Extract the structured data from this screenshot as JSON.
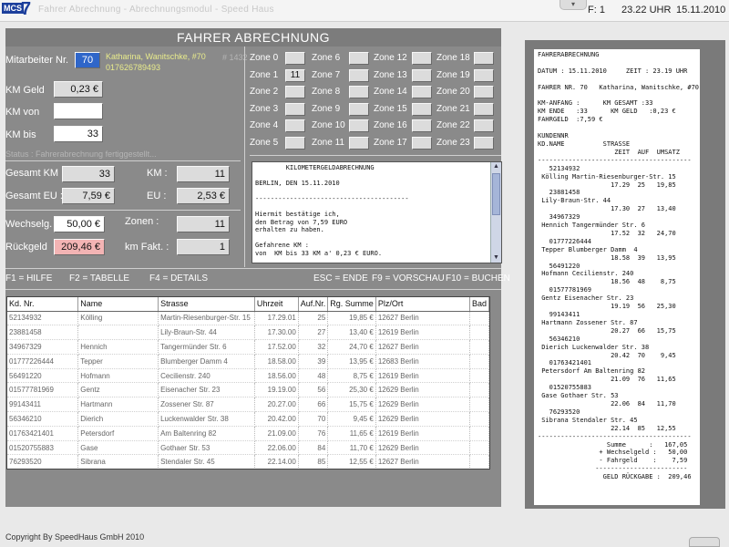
{
  "topbar": {
    "logo_text": "MCS",
    "logo_number": "7",
    "title": "Fahrer Abrechnung - Abrechnungsmodul - Speed Haus",
    "tab_symbol": "▾",
    "field_label": "F: 1",
    "time": "23.22 UHR",
    "date": "15.11.2010"
  },
  "header": {
    "title": "FAHRER ABRECHNUNG"
  },
  "form": {
    "mitarbeiter_label": "Mitarbeiter Nr.",
    "mitarbeiter_value": "70",
    "mitarbeiter_name": "Katharina, Wanitschke, #70",
    "mitarbeiter_phone": "017626789493",
    "terminal": "# 1432",
    "km_geld_label": "KM Geld",
    "km_geld_value": "0,23 €",
    "km_von_label": "KM von",
    "km_von_value": "",
    "km_bis_label": "KM bis",
    "km_bis_value": "33",
    "status_text": "Status : Fahrerabrechnung fertiggestellt...",
    "gesamt_km_label": "Gesamt KM :",
    "gesamt_km_value": "33",
    "km_label": "KM :",
    "km_value": "11",
    "gesamt_eu_label": "Gesamt EU :",
    "gesamt_eu_value": "7,59 €",
    "eu_label": "EU :",
    "eu_value": "2,53 €",
    "wechselg_label": "Wechselg.",
    "wechselg_value": "50,00 €",
    "zonen_label": "Zonen      :",
    "zonen_value": "11",
    "rueckgeld_label": "Rückgeld",
    "rueckgeld_value": "209,46 €",
    "km_fakt_label": "km Fakt. :",
    "km_fakt_value": "1"
  },
  "zones": [
    {
      "label": "Zone  0",
      "value": ""
    },
    {
      "label": "Zone  1",
      "value": "11"
    },
    {
      "label": "Zone  2",
      "value": ""
    },
    {
      "label": "Zone  3",
      "value": ""
    },
    {
      "label": "Zone  4",
      "value": ""
    },
    {
      "label": "Zone  5",
      "value": ""
    },
    {
      "label": "Zone  6",
      "value": ""
    },
    {
      "label": "Zone  7",
      "value": ""
    },
    {
      "label": "Zone  8",
      "value": ""
    },
    {
      "label": "Zone  9",
      "value": ""
    },
    {
      "label": "Zone 10",
      "value": ""
    },
    {
      "label": "Zone 11",
      "value": ""
    },
    {
      "label": "Zone 12",
      "value": ""
    },
    {
      "label": "Zone 13",
      "value": ""
    },
    {
      "label": "Zone 14",
      "value": ""
    },
    {
      "label": "Zone 15",
      "value": ""
    },
    {
      "label": "Zone 16",
      "value": ""
    },
    {
      "label": "Zone 17",
      "value": ""
    },
    {
      "label": "Zone 18",
      "value": ""
    },
    {
      "label": "Zone 19",
      "value": ""
    },
    {
      "label": "Zone 20",
      "value": ""
    },
    {
      "label": "Zone 21",
      "value": ""
    },
    {
      "label": "Zone 22",
      "value": ""
    },
    {
      "label": "Zone 23",
      "value": ""
    }
  ],
  "km_text": "        KILOMETERGELDABRECHNUNG\n\nBERLIN, DEN 15.11.2010\n\n----------------------------------------\n\nHiermit bestätige ich,\nden Betrag von 7,59 EURO\nerhalten zu haben.\n\nGefahrene KM :\nvon  KM bis 33 KM a' 0,23 € EURO.",
  "scroll_up": "▲",
  "scroll_down": "▼",
  "fkeys": {
    "f1": "F1 = HILFE",
    "f2": "F2 = TABELLE",
    "f4": "F4 = DETAILS",
    "esc": "ESC = ENDE",
    "f9": "F9 = VORSCHAU",
    "f10": "F10 = BUCHEN"
  },
  "table": {
    "headers": [
      "Kd. Nr.",
      "Name",
      "Strasse",
      "Uhrzeit",
      "Auf.Nr.",
      "Rg. Summe",
      "Plz/Ort",
      "Bad"
    ],
    "rows": [
      [
        "52134932",
        "Kölling",
        "Martin-Riesenburger-Str. 15",
        "17.29.01",
        "25",
        "19,85 €",
        "12627 Berlin",
        ""
      ],
      [
        "23881458",
        "",
        "Lily-Braun-Str. 44",
        "17.30.00",
        "27",
        "13,40 €",
        "12619 Berlin",
        ""
      ],
      [
        "34967329",
        "Hennich",
        "Tangermünder Str. 6",
        "17.52.00",
        "32",
        "24,70 €",
        "12627 Berlin",
        ""
      ],
      [
        "01777226444",
        "Tepper",
        "Blumberger Damm 4",
        "18.58.00",
        "39",
        "13,95 €",
        "12683 Berlin",
        ""
      ],
      [
        "56491220",
        "Hofmann",
        "Cecilienstr. 240",
        "18.56.00",
        "48",
        "8,75 €",
        "12619 Berlin",
        ""
      ],
      [
        "01577781969",
        "Gentz",
        "Eisenacher Str. 23",
        "19.19.00",
        "56",
        "25,30 €",
        "12629 Berlin",
        ""
      ],
      [
        "99143411",
        "Hartmann",
        "Zossener Str. 87",
        "20.27.00",
        "66",
        "15,75 €",
        "12629 Berlin",
        ""
      ],
      [
        "56346210",
        "Dierich",
        "Luckenwalder Str. 38",
        "20.42.00",
        "70",
        "9,45 €",
        "12629 Berlin",
        ""
      ],
      [
        "01763421401",
        "Petersdorf",
        "Am Baltenring 82",
        "21.09.00",
        "76",
        "11,65 €",
        "12619 Berlin",
        ""
      ],
      [
        "01520755883",
        "Gase",
        "Gothaer Str. 53",
        "22.06.00",
        "84",
        "11,70 €",
        "12629 Berlin",
        ""
      ],
      [
        "76293520",
        "Sibrana",
        "Stendaler Str. 45",
        "22.14.00",
        "85",
        "12,55 €",
        "12627 Berlin",
        ""
      ]
    ]
  },
  "receipt_text": "FAHRERABRECHNUNG\n\nDATUM : 15.11.2010     ZEIT : 23.19 UHR\n\nFAHRER NR. 70   Katharina, Wanitschke, #70\n\nKM-ANFANG :      KM GESAMT :33\nKM ENDE   :33      KM GELD   :0,23 €\nFAHRGELD  :7,59 €\n\nKUNDENNR\nKD.NAME          STRASSE\n                    ZEIT  AUF  UMSATZ\n----------------------------------------\n   52134932\n Kölling Martin-Riesenburger-Str. 15\n                   17.29  25   19,85\n   23881458\n Lily-Braun-Str. 44\n                   17.30  27   13,40\n   34967329\n Hennich Tangermünder Str. 6\n                   17.52  32   24,70\n   01777226444\n Tepper Blumberger Damm  4\n                   18.58  39   13,95\n   56491220\n Hofmann Cecilienstr. 240\n                   18.56  48    8,75\n   01577781969\n Gentz Eisenacher Str. 23\n                   19.19  56   25,30\n   99143411\n Hartmann Zossener Str. 87\n                   20.27  66   15,75\n   56346210\n Dierich Luckenwalder Str. 38\n                   20.42  70    9,45\n   01763421401\n Petersdorf Am Baltenring 82\n                   21.09  76   11,65\n   01520755883\n Gase Gothaer Str. 53\n                   22.06  84   11,70\n   76293520\n Sibrana Stendaler Str. 45\n                   22.14  85   12,55\n----------------------------------------\n                  Summe      :   167,05\n                + Wechselgeld :   50,00\n                - Fahrgeld    :    7,59\n               ------------------------\n                 GELD RÜCKGABE :  209,46",
  "footer": {
    "copyright": "Copyright By SpeedHaus GmbH 2010"
  }
}
